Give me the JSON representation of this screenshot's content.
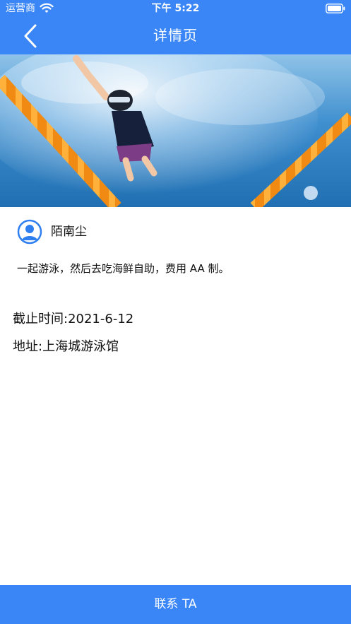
{
  "status_bar": {
    "carrier": "运营商",
    "time": "下午 5:22",
    "icons": [
      "wifi-icon",
      "battery-icon"
    ]
  },
  "nav": {
    "title": "详情页",
    "back_icon": "chevron-left-icon"
  },
  "hero_image": {
    "subject": "swimmer-photo"
  },
  "post": {
    "author_name": "陌南尘",
    "avatar_icon": "user-avatar-icon",
    "description": "一起游泳，然后去吃海鲜自助，费用 AA 制。",
    "deadline": "截止时间:2021-6-12",
    "address": "地址:上海城游泳馆"
  },
  "footer": {
    "contact_label": "联系 TA"
  },
  "colors": {
    "primary_blue": "#3a86f7",
    "background": "#ffffff",
    "text": "#111111"
  }
}
